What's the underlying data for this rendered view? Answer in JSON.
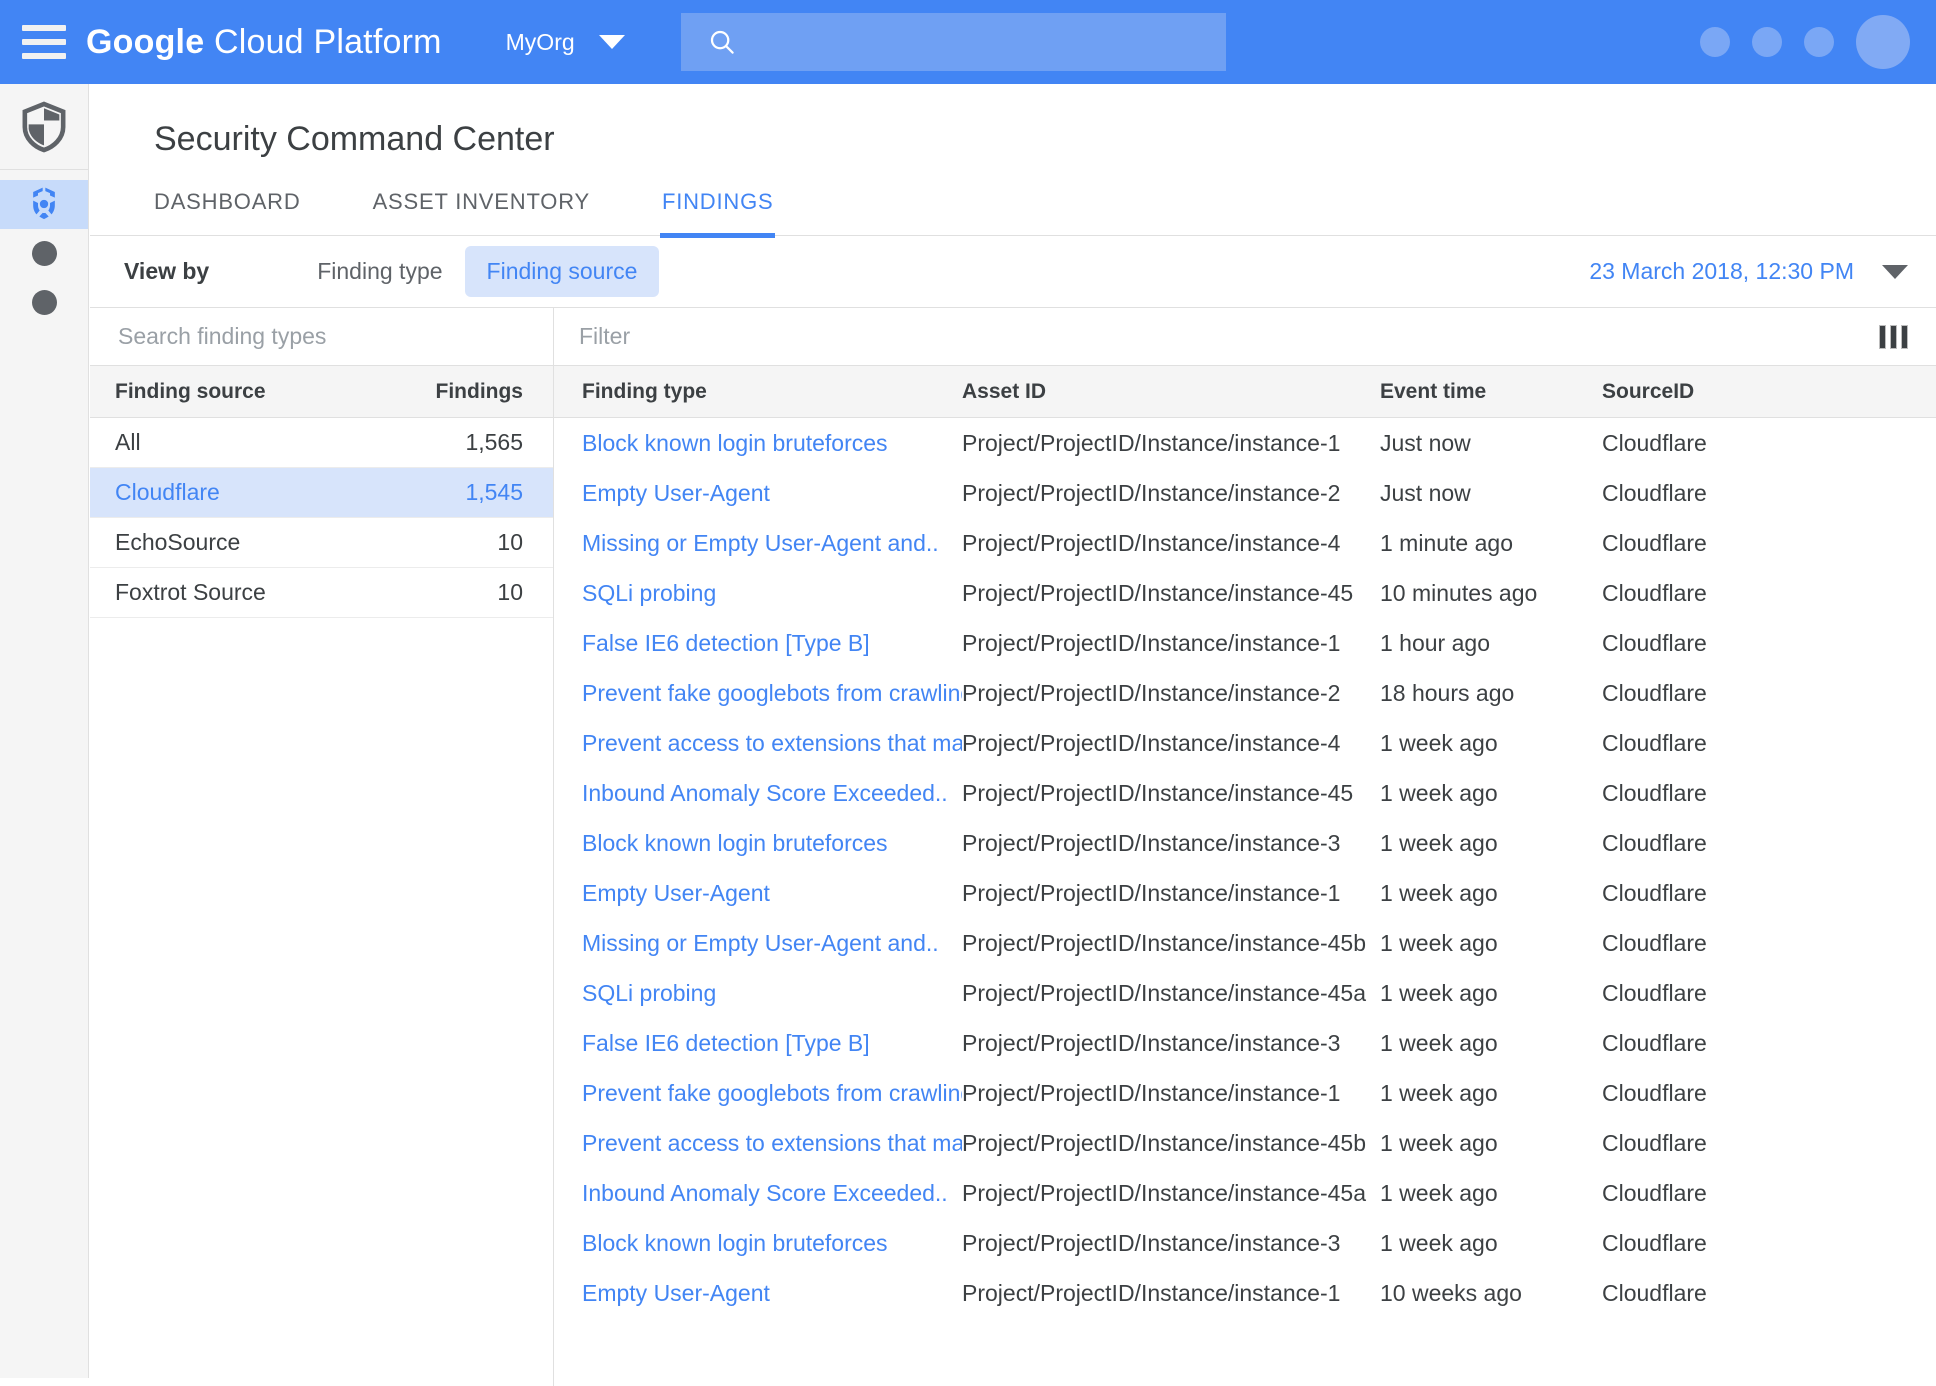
{
  "topbar": {
    "menu_icon": "hamburger-icon",
    "brand_strong": "Google",
    "brand_light": " Cloud Platform",
    "org_name": "MyOrg",
    "org_caret_icon": "chevron-down-icon",
    "search_icon": "search-icon",
    "search_value": "",
    "search_placeholder": "",
    "accent_color": "#4285F4",
    "right_icons": [
      "circle-icon",
      "circle-icon",
      "circle-icon"
    ],
    "avatar_label": "avatar"
  },
  "rail": {
    "logo_icon": "shield-logo-icon",
    "items": [
      {
        "icon": "security-command-center-icon",
        "active": true
      },
      {
        "icon": "dot-icon",
        "active": false
      },
      {
        "icon": "dot-icon",
        "active": false
      }
    ]
  },
  "page": {
    "title": "Security Command Center",
    "tabs": [
      {
        "label": "DASHBOARD",
        "active": false
      },
      {
        "label": "ASSET INVENTORY",
        "active": false
      },
      {
        "label": "FINDINGS",
        "active": true
      }
    ]
  },
  "viewby": {
    "label": "View by",
    "options": [
      {
        "label": "Finding type",
        "active": false
      },
      {
        "label": "Finding source",
        "active": true
      }
    ],
    "date": "23 March 2018, 12:30 PM",
    "date_caret_icon": "chevron-down-icon"
  },
  "left_panel": {
    "search_value": "",
    "search_placeholder": "Search finding types",
    "columns": [
      "Finding source",
      "Findings"
    ],
    "rows": [
      {
        "source": "All",
        "findings": "1,565",
        "selected": false
      },
      {
        "source": "Cloudflare",
        "findings": "1,545",
        "selected": true
      },
      {
        "source": "EchoSource",
        "findings": "10",
        "selected": false
      },
      {
        "source": "Foxtrot Source",
        "findings": "10",
        "selected": false
      }
    ]
  },
  "right_panel": {
    "filter_value": "",
    "filter_placeholder": "Filter",
    "columns_icon": "columns-icon",
    "columns": [
      "Finding type",
      "Asset ID",
      "Event time",
      "SourceID"
    ],
    "rows": [
      {
        "finding_type": "Block known login bruteforces",
        "asset_id": "Project/ProjectID/Instance/instance-1",
        "event_time": "Just now",
        "source_id": "Cloudflare"
      },
      {
        "finding_type": "Empty User-Agent",
        "asset_id": "Project/ProjectID/Instance/instance-2",
        "event_time": "Just now",
        "source_id": "Cloudflare"
      },
      {
        "finding_type": "Missing or Empty User-Agent and..",
        "asset_id": "Project/ProjectID/Instance/instance-4",
        "event_time": "1 minute ago",
        "source_id": "Cloudflare"
      },
      {
        "finding_type": "SQLi probing",
        "asset_id": "Project/ProjectID/Instance/instance-45",
        "event_time": "10 minutes ago",
        "source_id": "Cloudflare"
      },
      {
        "finding_type": "False IE6 detection [Type B]",
        "asset_id": "Project/ProjectID/Instance/instance-1",
        "event_time": "1 hour ago",
        "source_id": "Cloudflare"
      },
      {
        "finding_type": "Prevent fake googlebots from crawling",
        "asset_id": "Project/ProjectID/Instance/instance-2",
        "event_time": "18 hours ago",
        "source_id": "Cloudflare"
      },
      {
        "finding_type": "Prevent access to extensions that may..",
        "asset_id": "Project/ProjectID/Instance/instance-4",
        "event_time": "1 week ago",
        "source_id": "Cloudflare"
      },
      {
        "finding_type": "Inbound Anomaly Score Exceeded..",
        "asset_id": "Project/ProjectID/Instance/instance-45",
        "event_time": "1 week ago",
        "source_id": "Cloudflare"
      },
      {
        "finding_type": "Block known login bruteforces",
        "asset_id": "Project/ProjectID/Instance/instance-3",
        "event_time": "1 week ago",
        "source_id": "Cloudflare"
      },
      {
        "finding_type": "Empty User-Agent",
        "asset_id": "Project/ProjectID/Instance/instance-1",
        "event_time": "1 week ago",
        "source_id": "Cloudflare"
      },
      {
        "finding_type": "Missing or Empty User-Agent and..",
        "asset_id": "Project/ProjectID/Instance/instance-45b",
        "event_time": "1 week ago",
        "source_id": "Cloudflare"
      },
      {
        "finding_type": "SQLi probing",
        "asset_id": "Project/ProjectID/Instance/instance-45a",
        "event_time": "1 week ago",
        "source_id": "Cloudflare"
      },
      {
        "finding_type": "False IE6 detection [Type B]",
        "asset_id": "Project/ProjectID/Instance/instance-3",
        "event_time": "1 week ago",
        "source_id": "Cloudflare"
      },
      {
        "finding_type": "Prevent fake googlebots from crawling",
        "asset_id": "Project/ProjectID/Instance/instance-1",
        "event_time": "1 week ago",
        "source_id": "Cloudflare"
      },
      {
        "finding_type": "Prevent access to extensions that may..",
        "asset_id": "Project/ProjectID/Instance/instance-45b",
        "event_time": "1 week ago",
        "source_id": "Cloudflare"
      },
      {
        "finding_type": "Inbound Anomaly Score Exceeded..",
        "asset_id": "Project/ProjectID/Instance/instance-45a",
        "event_time": "1 week ago",
        "source_id": "Cloudflare"
      },
      {
        "finding_type": "Block known login bruteforces",
        "asset_id": "Project/ProjectID/Instance/instance-3",
        "event_time": "1 week ago",
        "source_id": "Cloudflare"
      },
      {
        "finding_type": "Empty User-Agent",
        "asset_id": "Project/ProjectID/Instance/instance-1",
        "event_time": "10 weeks ago",
        "source_id": "Cloudflare"
      }
    ]
  }
}
